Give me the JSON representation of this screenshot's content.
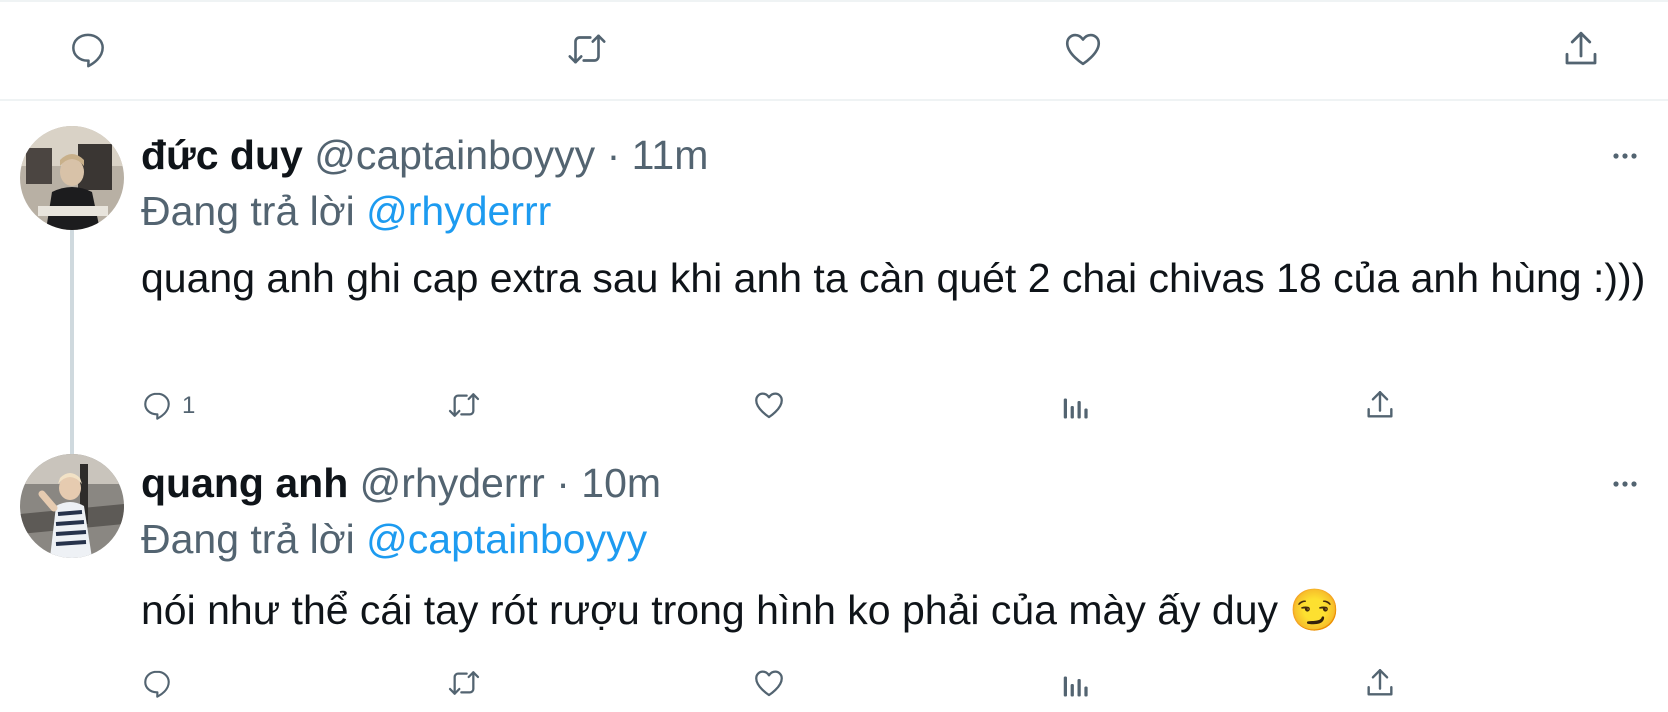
{
  "tweets": [
    {
      "display_name": "đức duy",
      "handle": "@captainboyyy",
      "separator": "·",
      "time": "11m",
      "reply_prefix": "Đang trả lời",
      "reply_to": "@rhyderrr",
      "text": "quang anh ghi cap extra sau khi anh ta càn quét 2 chai chivas 18 của anh hùng :)))",
      "reply_count": "1"
    },
    {
      "display_name": "quang anh",
      "handle": "@rhyderrr",
      "separator": "·",
      "time": "10m",
      "reply_prefix": "Đang trả lời",
      "reply_to": "@captainboyyy",
      "text": "nói như thể cái tay rót rượu trong hình ko phải của mày ấy duy 😏"
    }
  ],
  "icons": {
    "reply": "reply-icon",
    "retweet": "retweet-icon",
    "like": "like-icon",
    "share": "share-icon",
    "views": "views-icon",
    "more": "more-icon"
  },
  "colors": {
    "text": "#0f1419",
    "muted": "#536471",
    "link": "#1d9bf0",
    "divider": "#eff3f4",
    "thread_line": "#cfd9de"
  }
}
